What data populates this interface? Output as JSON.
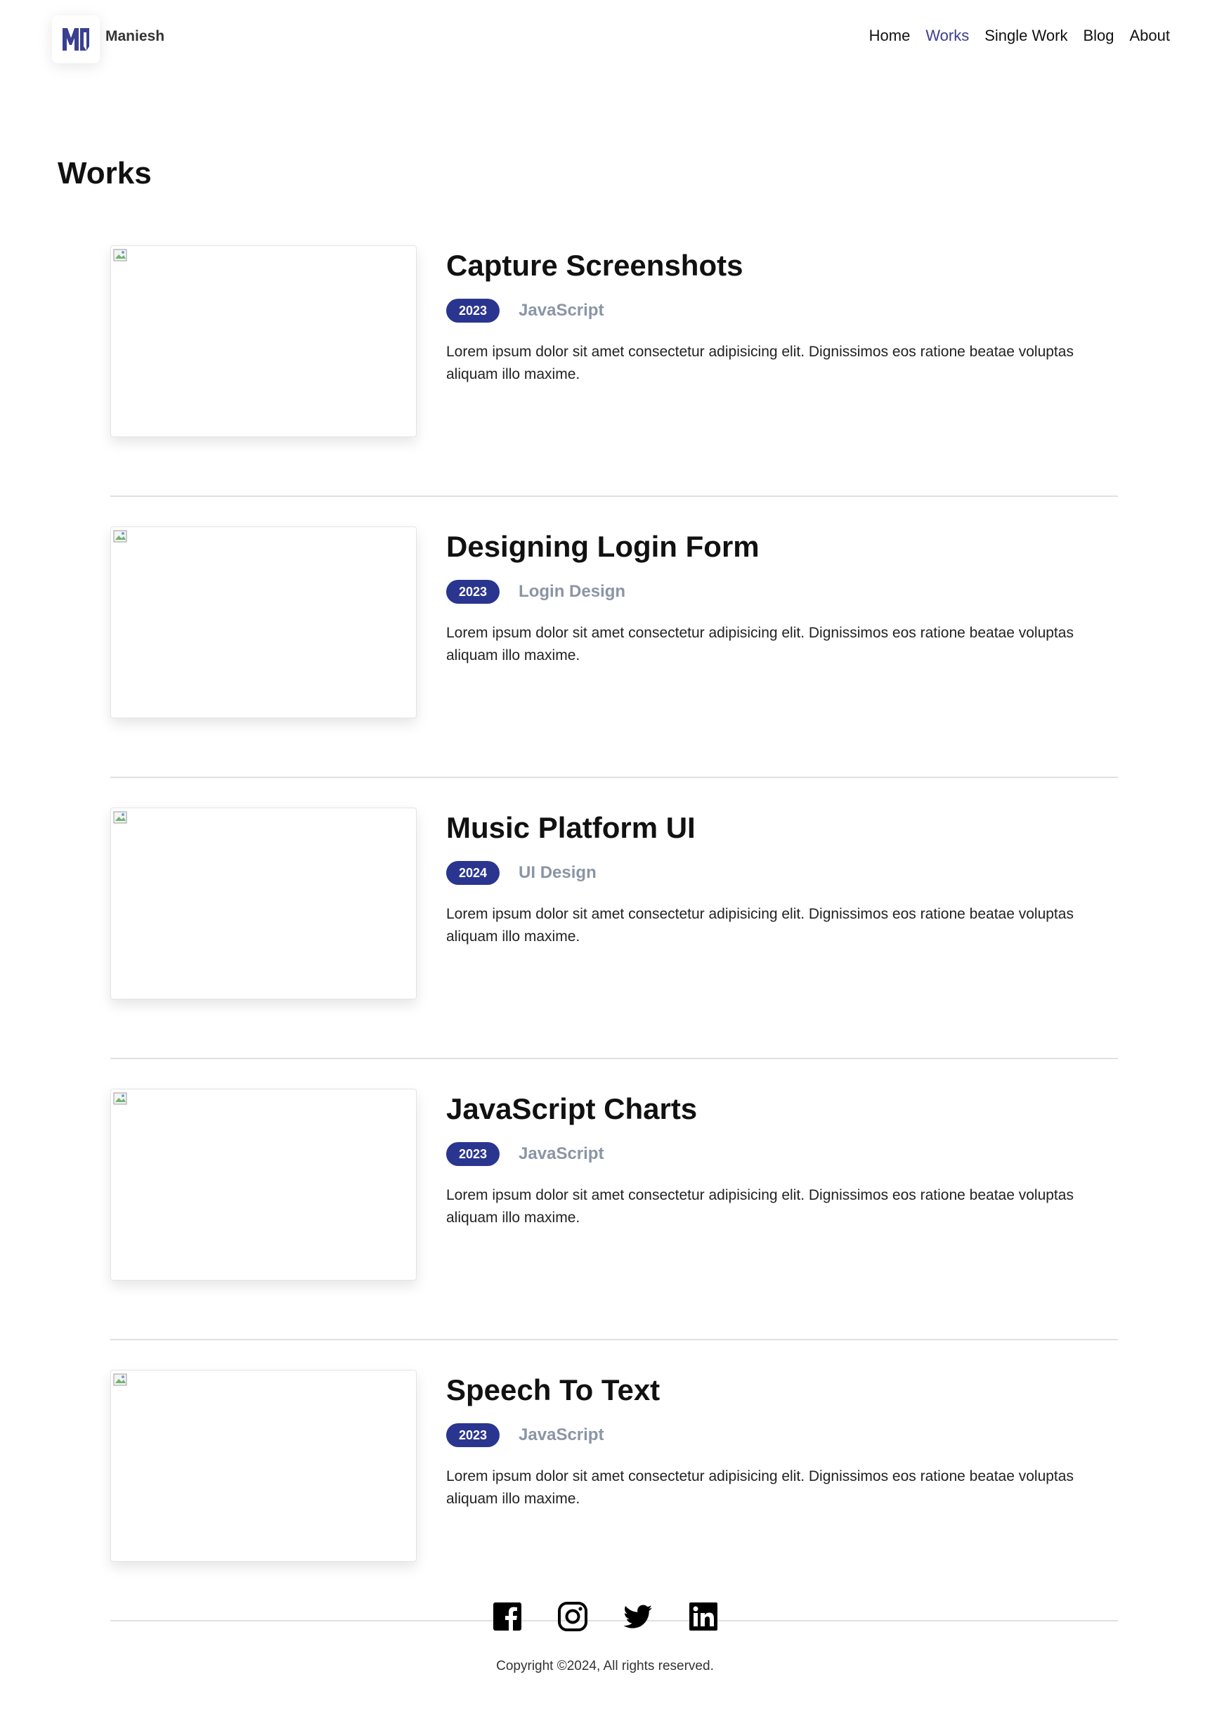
{
  "brand": {
    "name": "Maniesh",
    "logo_icon": "mq-logo-icon",
    "accent": "#3a3f8f"
  },
  "nav": {
    "items": [
      "Home",
      "Works",
      "Single Work",
      "Blog",
      "About"
    ],
    "active": "Works"
  },
  "page": {
    "title": "Works"
  },
  "works": [
    {
      "title": "Capture Screenshots",
      "year": "2023",
      "category": "JavaScript",
      "description": "Lorem ipsum dolor sit amet consectetur adipisicing elit. Dignissimos eos ratione beatae voluptas aliquam illo maxime."
    },
    {
      "title": "Designing Login Form",
      "year": "2023",
      "category": "Login Design",
      "description": "Lorem ipsum dolor sit amet consectetur adipisicing elit. Dignissimos eos ratione beatae voluptas aliquam illo maxime."
    },
    {
      "title": "Music Platform UI",
      "year": "2024",
      "category": "UI Design",
      "description": "Lorem ipsum dolor sit amet consectetur adipisicing elit. Dignissimos eos ratione beatae voluptas aliquam illo maxime."
    },
    {
      "title": "JavaScript Charts",
      "year": "2023",
      "category": "JavaScript",
      "description": "Lorem ipsum dolor sit amet consectetur adipisicing elit. Dignissimos eos ratione beatae voluptas aliquam illo maxime."
    },
    {
      "title": "Speech To Text",
      "year": "2023",
      "category": "JavaScript",
      "description": "Lorem ipsum dolor sit amet consectetur adipisicing elit. Dignissimos eos ratione beatae voluptas aliquam illo maxime."
    }
  ],
  "footer": {
    "social_icons": [
      "facebook-icon",
      "instagram-icon",
      "twitter-icon",
      "linkedin-icon"
    ],
    "copyright": "Copyright ©2024, All rights reserved."
  },
  "colors": {
    "badge": "#2a3590",
    "category": "#8a95a5",
    "divider": "#e0e0e0"
  }
}
